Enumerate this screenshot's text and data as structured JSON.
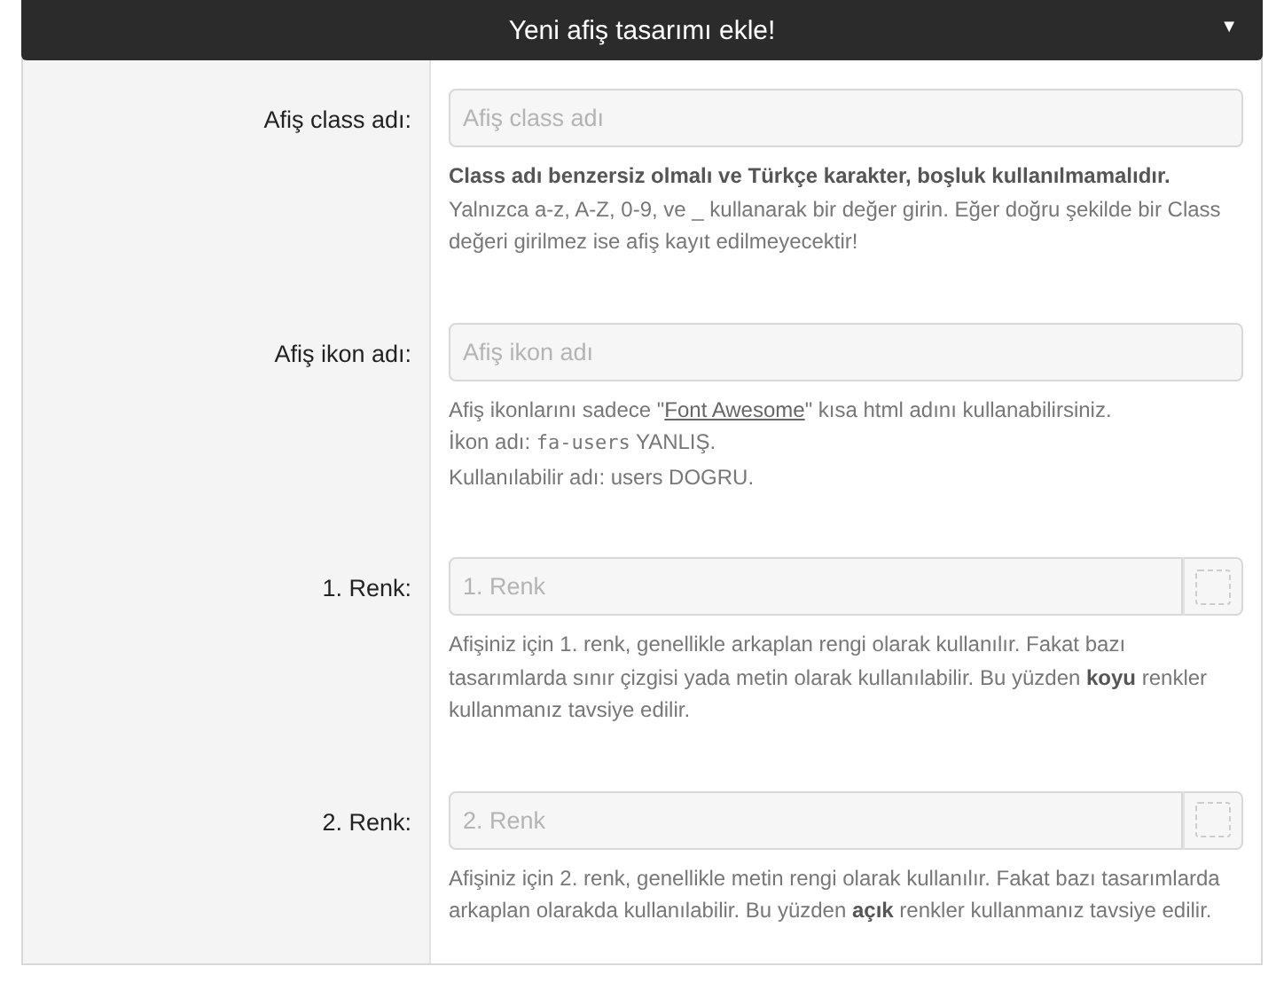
{
  "header": {
    "title": "Yeni afiş tasarımı ekle!",
    "caret": "▼"
  },
  "fields": [
    {
      "label": "Afiş class adı:",
      "kind": "text",
      "placeholder": "Afiş class adı",
      "help": [
        [
          {
            "kind": "bold",
            "text": "Class adı benzersiz olmalı ve Türkçe karakter, boşluk kullanılmamalıdır."
          }
        ],
        [
          {
            "kind": "text",
            "text": "Yalnızca a-z, A-Z, 0-9, ve _ kullanarak bir değer girin. Eğer doğru şekilde bir Class değeri girilmez ise afiş kayıt edilmeyecektir!"
          }
        ]
      ]
    },
    {
      "label": "Afiş ikon adı:",
      "kind": "text",
      "placeholder": "Afiş ikon adı",
      "help": [
        [
          {
            "kind": "text",
            "text": "Afiş ikonlarını sadece \""
          },
          {
            "kind": "link",
            "text": "Font Awesome"
          },
          {
            "kind": "text",
            "text": "\" kısa html adını kullanabilirsiniz."
          }
        ],
        [
          {
            "kind": "text",
            "text": "İkon adı: "
          },
          {
            "kind": "code",
            "text": "fa-users"
          },
          {
            "kind": "text",
            "text": " YANLIŞ."
          }
        ],
        [
          {
            "kind": "text",
            "text": "Kullanılabilir adı: users DOGRU."
          }
        ]
      ]
    },
    {
      "label": "1. Renk:",
      "kind": "color",
      "placeholder": "1. Renk",
      "help": [
        [
          {
            "kind": "text",
            "text": "Afişiniz için 1. renk, genellikle arkaplan rengi olarak kullanılır. Fakat bazı tasarımlarda sınır çizgisi yada metin olarak kullanılabilir. Bu yüzden "
          },
          {
            "kind": "bold",
            "text": "koyu"
          },
          {
            "kind": "text",
            "text": " renkler kullanmanız tavsiye edilir."
          }
        ]
      ]
    },
    {
      "label": "2. Renk:",
      "kind": "color",
      "placeholder": "2. Renk",
      "help": [
        [
          {
            "kind": "text",
            "text": "Afişiniz için 2. renk, genellikle metin rengi olarak kullanılır. Fakat bazı tasarımlarda arkaplan olarakda kullanılabilir. Bu yüzden "
          },
          {
            "kind": "bold",
            "text": "açık"
          },
          {
            "kind": "text",
            "text": " renkler kullanmanız tavsiye edilir."
          }
        ]
      ]
    }
  ]
}
